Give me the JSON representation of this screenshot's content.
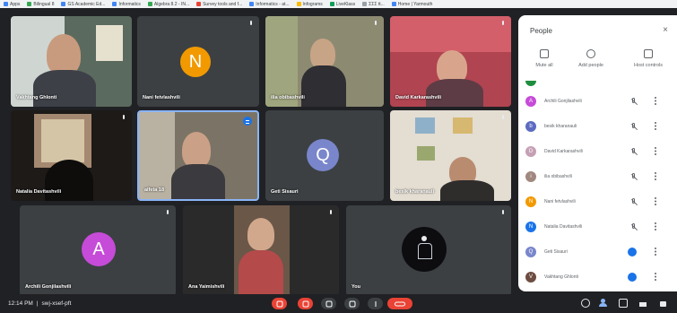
{
  "bookmarks": [
    "Apps",
    "Bilingual 8",
    "GS Academic Ed...",
    "Informatics",
    "Algebra 8.2 - IN...",
    "Survey tools and f...",
    "Informatics - at...",
    "Infograms",
    "LiveKlass",
    "ΣΣΣ tt...",
    "Home | Yarmouth"
  ],
  "tiles": [
    {
      "name": "Vakhtang Ghlonti",
      "kind": "video"
    },
    {
      "name": "Nani fetvlashvili",
      "kind": "avatar",
      "letter": "N",
      "color": "#f29900"
    },
    {
      "name": "ilia obibashvili",
      "kind": "video"
    },
    {
      "name": "David Karkarashvili",
      "kind": "video"
    },
    {
      "name": "Natalia Davitashvili",
      "kind": "video"
    },
    {
      "name": "alfeta 18",
      "kind": "video"
    },
    {
      "name": "Geti Sisauri",
      "kind": "avatar",
      "letter": "Q",
      "color": "#7986cb"
    },
    {
      "name": "besik kharanauli",
      "kind": "video"
    },
    {
      "name": "Archili Gonjilashvili",
      "kind": "avatar",
      "letter": "A",
      "color": "#c64bd8"
    },
    {
      "name": "Ana Yaimishvili",
      "kind": "video"
    },
    {
      "name": "You",
      "kind": "video"
    }
  ],
  "bottom": {
    "time": "12:14 PM",
    "separator": "|",
    "code": "swj-xsef-pft"
  },
  "panel": {
    "title": "People",
    "close": "×",
    "buttons": [
      "Mute all",
      "Add people",
      "Host controls"
    ],
    "participants": [
      {
        "name": "Archili Gonjilashvili",
        "letter": "A",
        "color": "#c64bd8",
        "status": "muted"
      },
      {
        "name": "besik kharanauli",
        "letter": "b",
        "color": "#5c6bc0",
        "status": "muted"
      },
      {
        "name": "David Karkarashvili",
        "letter": "D",
        "color": "#c5a0b4",
        "status": "muted"
      },
      {
        "name": "ilia obibashvili",
        "letter": "i",
        "color": "#a1887f",
        "status": "muted"
      },
      {
        "name": "Nani fetvlashvili",
        "letter": "N",
        "color": "#f29900",
        "status": "muted"
      },
      {
        "name": "Natalia Davitashvili",
        "letter": "N",
        "color": "#1a73e8",
        "status": "muted"
      },
      {
        "name": "Geti Sisauri",
        "letter": "Q",
        "color": "#7986cb",
        "status": "talking"
      },
      {
        "name": "Vakhtang Ghlonti",
        "letter": "V",
        "color": "#6d4c41",
        "status": "talking"
      }
    ]
  }
}
